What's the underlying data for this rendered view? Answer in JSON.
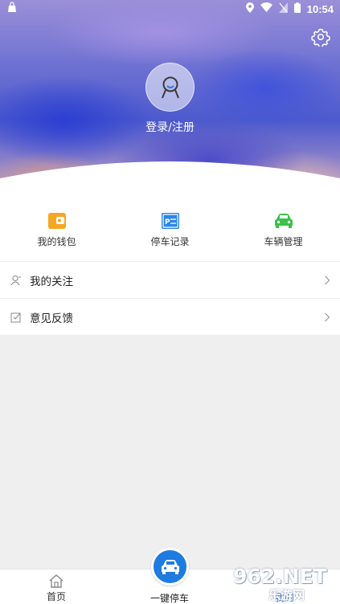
{
  "status_bar": {
    "time": "10:54",
    "icons": [
      "bag-icon",
      "location-icon",
      "wifi-icon",
      "no-sim-icon",
      "battery-icon"
    ]
  },
  "header": {
    "login_label": "登录/注册",
    "icons": [
      "settings-icon",
      "avatar-icon"
    ]
  },
  "quick_actions": [
    {
      "label": "我的钱包",
      "icon": "wallet-icon",
      "color": "#f6a623"
    },
    {
      "label": "停车记录",
      "icon": "parking-record-icon",
      "color": "#2b86e8"
    },
    {
      "label": "车辆管理",
      "icon": "car-icon",
      "color": "#3cc14a"
    }
  ],
  "menu": [
    {
      "label": "我的关注",
      "icon": "user-follow-icon"
    },
    {
      "label": "意见反馈",
      "icon": "feedback-icon"
    }
  ],
  "bottom_nav": {
    "home_label": "首页",
    "park_label": "一键停车",
    "mine_label": "我的"
  },
  "watermark": {
    "big_text": "962.NET",
    "small_text": "乐游网"
  },
  "colors": {
    "accent": "#1e7be0",
    "background": "#efefef"
  }
}
